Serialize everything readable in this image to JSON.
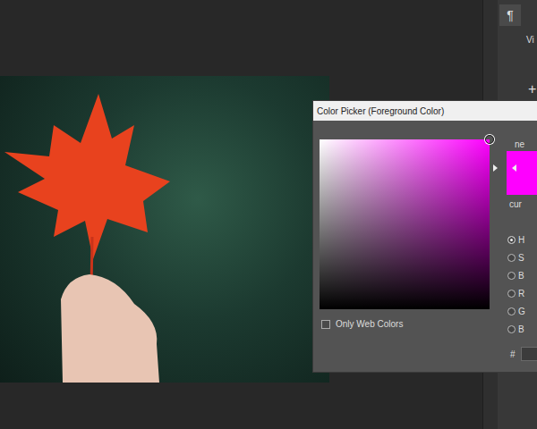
{
  "panel": {
    "paragraph_icon": "¶",
    "label": "Vi",
    "add_icon": "+"
  },
  "dialog": {
    "title": "Color Picker (Foreground Color)",
    "hue": 0.167,
    "saturation": 1,
    "brightness": 1,
    "new_label": "ne",
    "current_label": "cur",
    "only_web_colors": {
      "label": "Only Web Colors",
      "checked": false
    },
    "modes": [
      {
        "label": "H",
        "selected": true
      },
      {
        "label": "S",
        "selected": false
      },
      {
        "label": "B",
        "selected": false
      },
      {
        "label": "R",
        "selected": false
      },
      {
        "label": "G",
        "selected": false
      },
      {
        "label": "B",
        "selected": false
      }
    ],
    "hex_label": "#"
  }
}
